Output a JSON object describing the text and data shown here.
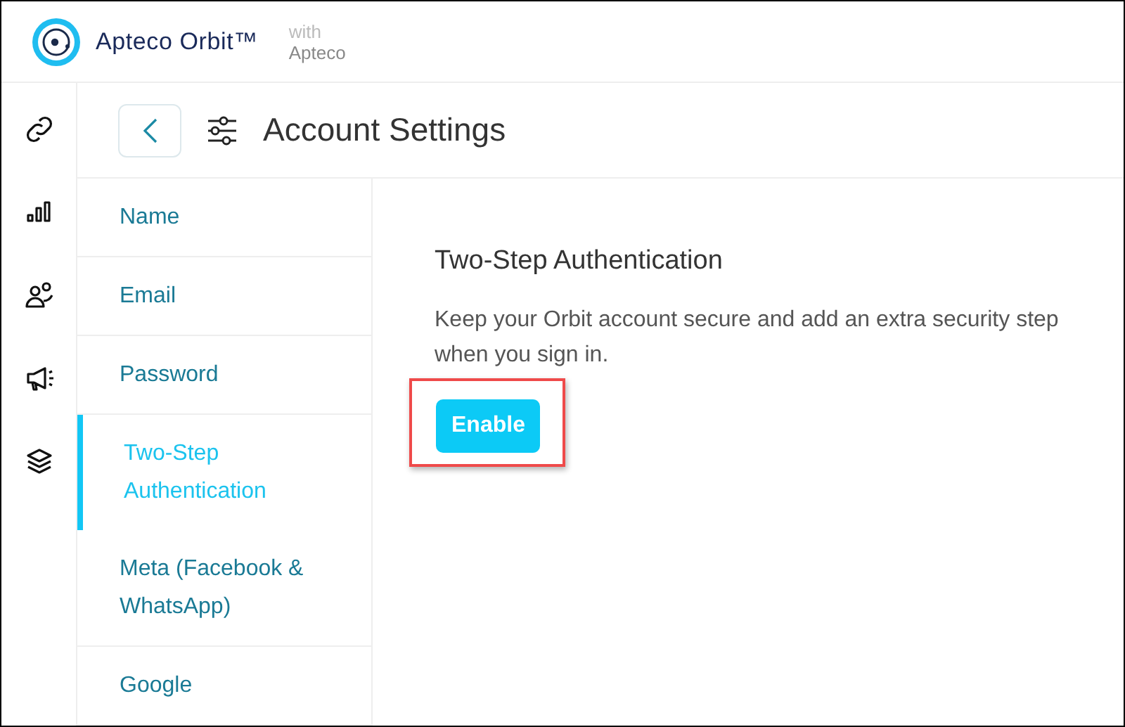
{
  "header": {
    "product": "Apteco Orbit™",
    "with_label": "with",
    "with_brand": "Apteco"
  },
  "rail": [
    {
      "kind": "link"
    },
    {
      "kind": "chart"
    },
    {
      "kind": "people"
    },
    {
      "kind": "megaphone"
    },
    {
      "kind": "layers"
    }
  ],
  "page": {
    "title": "Account Settings"
  },
  "menu": [
    {
      "label": "Name",
      "selected": false
    },
    {
      "label": "Email",
      "selected": false
    },
    {
      "label": "Password",
      "selected": false
    },
    {
      "label": "Two-Step Authentication",
      "selected": true
    },
    {
      "label": "Meta (Facebook & WhatsApp)",
      "selected": false
    },
    {
      "label": "Google",
      "selected": false
    }
  ],
  "content": {
    "heading": "Two-Step Authentication",
    "text": "Keep your Orbit account secure and add an extra security step when you sign in.",
    "button": {
      "label": "Enable",
      "highlighted": true
    }
  }
}
